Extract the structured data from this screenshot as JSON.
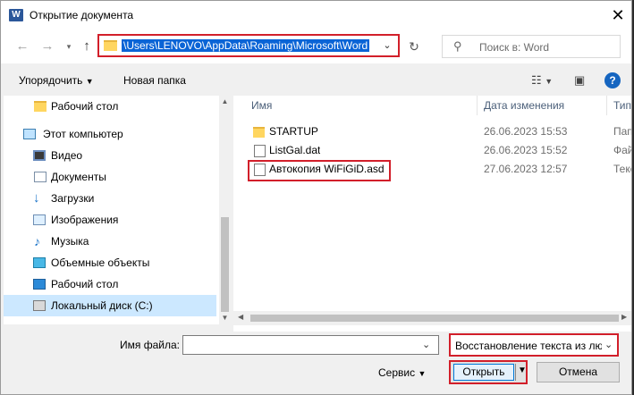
{
  "window": {
    "title": "Открытие документа",
    "app_icon_letter": "W"
  },
  "address_bar": {
    "path": "\\Users\\LENOVO\\AppData\\Roaming\\Microsoft\\Word",
    "search_placeholder": "Поиск в: Word"
  },
  "toolbar": {
    "organize_label": "Упорядочить",
    "new_folder_label": "Новая папка"
  },
  "nav_pane": {
    "items": [
      {
        "label": "Рабочий стол",
        "icon": "folder-yellow-icon"
      },
      {
        "label": "Этот компьютер",
        "icon": "computer-icon"
      },
      {
        "label": "Видео",
        "icon": "video-icon"
      },
      {
        "label": "Документы",
        "icon": "documents-icon"
      },
      {
        "label": "Загрузки",
        "icon": "download-icon"
      },
      {
        "label": "Изображения",
        "icon": "pictures-icon"
      },
      {
        "label": "Музыка",
        "icon": "music-icon"
      },
      {
        "label": "Объемные объекты",
        "icon": "3d-objects-icon"
      },
      {
        "label": "Рабочий стол",
        "icon": "desktop-icon"
      },
      {
        "label": "Локальный диск (C:)",
        "icon": "drive-icon"
      }
    ]
  },
  "file_list": {
    "columns": {
      "name": "Имя",
      "date": "Дата изменения",
      "type": "Тип"
    },
    "rows": [
      {
        "name": "STARTUP",
        "date": "26.06.2023 15:53",
        "type": "Папка",
        "icon": "folder-icon"
      },
      {
        "name": "ListGal.dat",
        "date": "26.06.2023 15:52",
        "type": "Файл",
        "icon": "file-icon"
      },
      {
        "name": "Автокопия WiFiGiD.asd",
        "date": "27.06.2023 12:57",
        "type": "Текст",
        "icon": "file-icon"
      }
    ]
  },
  "bottom": {
    "filename_label": "Имя файла:",
    "filename_value": "",
    "filetype_value": "Восстановление текста из любого файла (*.*)",
    "service_label": "Сервис",
    "open_label": "Открыть",
    "cancel_label": "Отмена"
  },
  "colors": {
    "highlight_border": "#d21f2a",
    "selection_blue": "#0a64d6",
    "nav_selected": "#cce8ff"
  }
}
